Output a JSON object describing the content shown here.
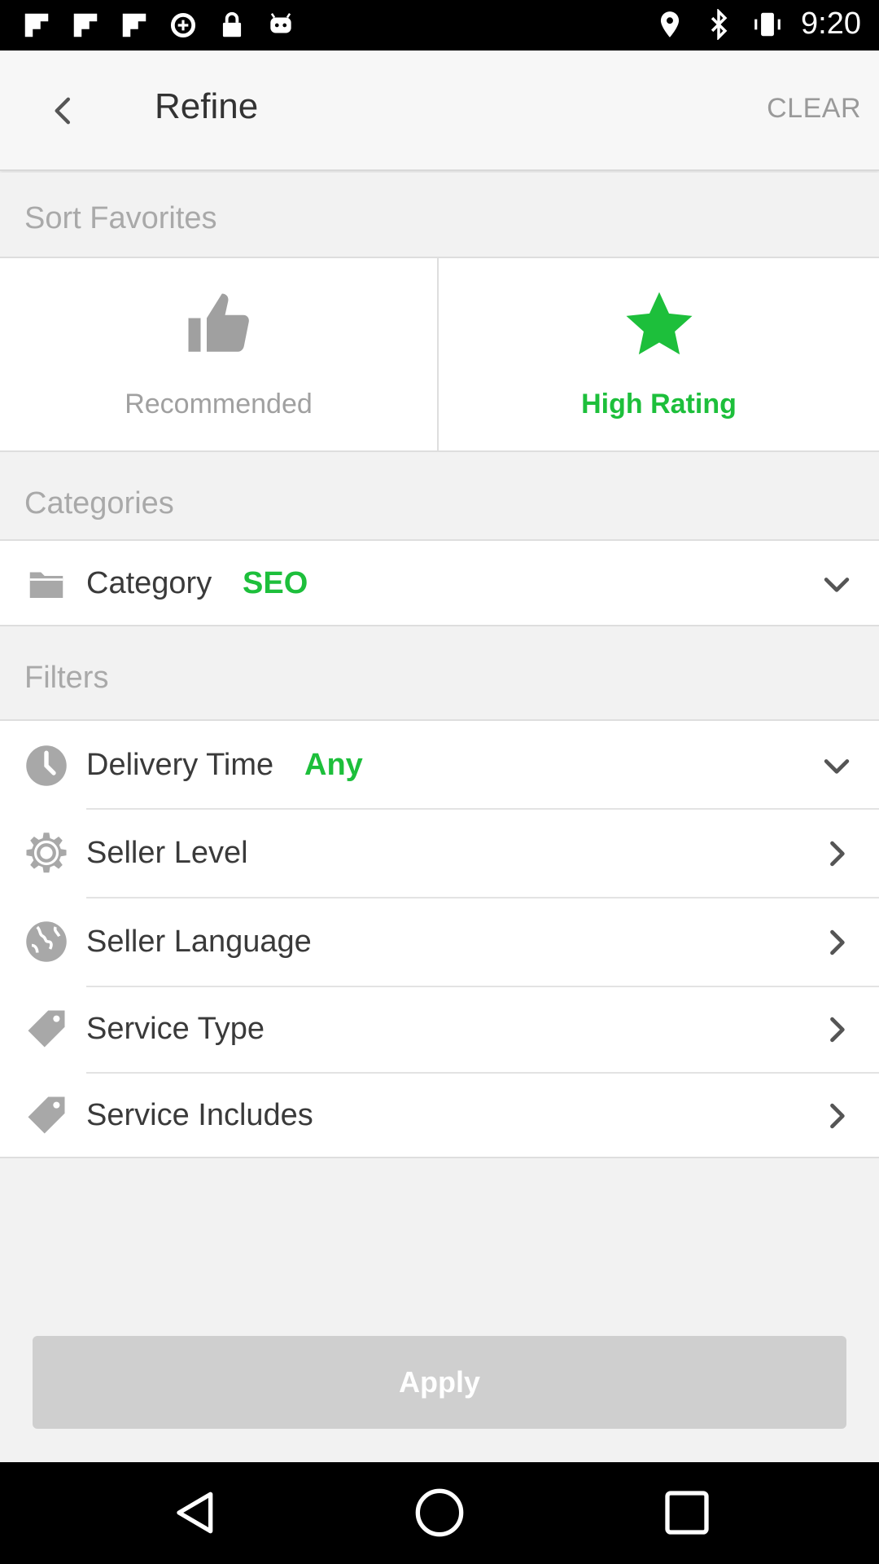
{
  "status_bar": {
    "time": "9:20",
    "left_icons": [
      "flipboard-icon",
      "flipboard-icon",
      "flipboard-icon",
      "data-saver-icon",
      "lock-icon",
      "android-icon"
    ],
    "right_icons": [
      "location-icon",
      "bluetooth-icon",
      "vibrate-icon"
    ]
  },
  "header": {
    "title": "Refine",
    "clear_label": "CLEAR"
  },
  "sort": {
    "section_title": "Sort Favorites",
    "options": [
      {
        "label": "Recommended",
        "icon": "thumbs-up-icon",
        "selected": false
      },
      {
        "label": "High Rating",
        "icon": "star-icon",
        "selected": true
      }
    ]
  },
  "categories": {
    "section_title": "Categories",
    "row": {
      "label": "Category",
      "value": "SEO",
      "icon": "folder-icon"
    }
  },
  "filters": {
    "section_title": "Filters",
    "rows": [
      {
        "label": "Delivery Time",
        "value": "Any",
        "icon": "clock-icon",
        "chevron": "down"
      },
      {
        "label": "Seller Level",
        "icon": "gear-icon",
        "chevron": "right"
      },
      {
        "label": "Seller Language",
        "icon": "globe-icon",
        "chevron": "right"
      },
      {
        "label": "Service Type",
        "icon": "tag-icon",
        "chevron": "right"
      },
      {
        "label": "Service Includes",
        "icon": "tag-icon",
        "chevron": "right"
      }
    ]
  },
  "apply_label": "Apply",
  "colors": {
    "accent": "#1dbf3b",
    "muted": "#a0a0a0",
    "apply_bg": "#cfcfcf"
  }
}
